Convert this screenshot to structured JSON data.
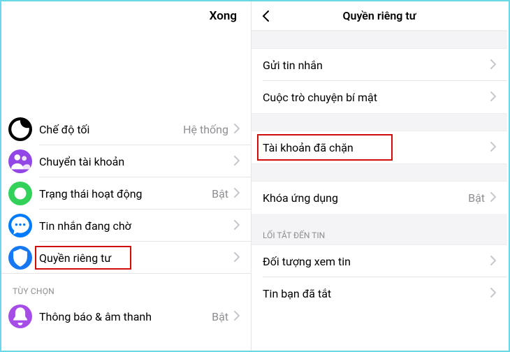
{
  "left": {
    "done": "Xong",
    "rows": {
      "dark_mode": {
        "label": "Chế độ tối",
        "value": "Hệ thống"
      },
      "switch_account": {
        "label": "Chuyển tài khoản"
      },
      "active_status": {
        "label": "Trạng thái hoạt động",
        "value": "Bật"
      },
      "pending_messages": {
        "label": "Tin nhắn đang chờ"
      },
      "privacy": {
        "label": "Quyền riêng tư"
      }
    },
    "section_options": "TÙY CHỌN",
    "notif_sound": {
      "label": "Thông báo & âm thanh",
      "value": "Bật"
    }
  },
  "right": {
    "title": "Quyền riêng tư",
    "send_message": "Gửi tin nhắn",
    "secret_chat": "Cuộc trò chuyện bí mật",
    "blocked_accounts": "Tài khoản đã chặn",
    "app_lock": {
      "label": "Khóa ứng dụng",
      "value": "Bật"
    },
    "section_story": "LỐI TẮT ĐẾN TIN",
    "story_audience": "Đối tượng xem tin",
    "story_muted": "Tin bạn đã tắt"
  }
}
